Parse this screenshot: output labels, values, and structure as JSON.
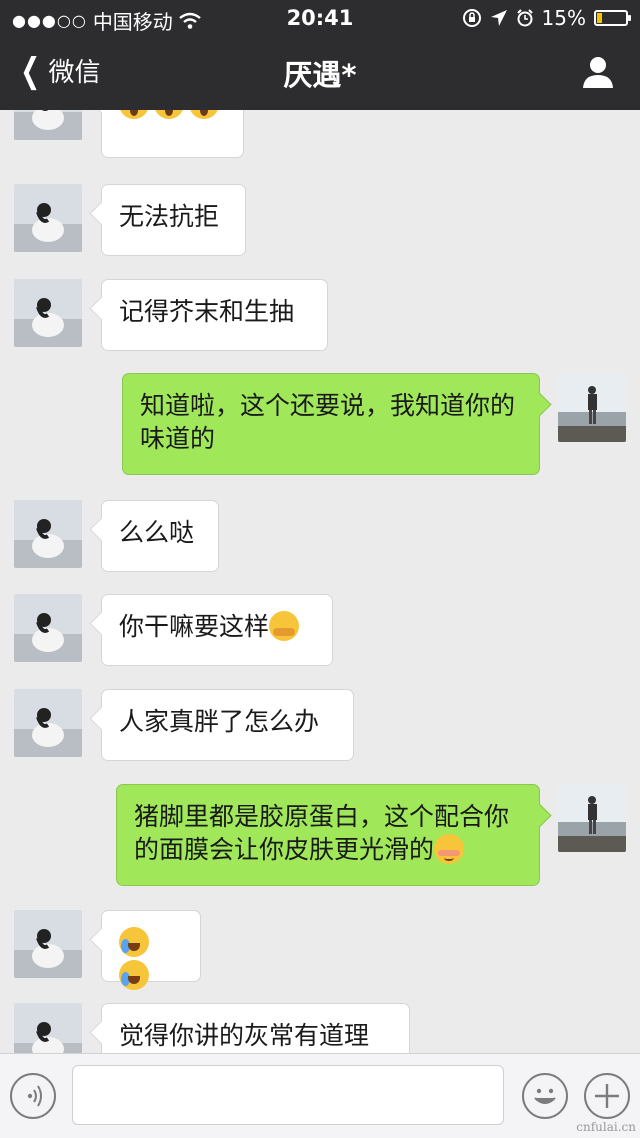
{
  "status_bar": {
    "signal": "●●●○○",
    "carrier": "中国移动",
    "time": "20:41",
    "battery": "15%",
    "battery_level": 0.15
  },
  "nav": {
    "back_label": "微信",
    "title": "厌遇*"
  },
  "messages": [
    {
      "side": "in",
      "text": "",
      "emoji": [
        "scream-emoji",
        "scream-emoji",
        "scream-emoji"
      ]
    },
    {
      "side": "in",
      "text": "无法抗拒"
    },
    {
      "side": "in",
      "text": "记得芥末和生抽"
    },
    {
      "side": "out",
      "text": "知道啦，这个还要说，我知道你的味道的"
    },
    {
      "side": "in",
      "text": "么么哒"
    },
    {
      "side": "in",
      "text": "你干嘛要这样",
      "emoji": [
        "hug-emoji"
      ]
    },
    {
      "side": "in",
      "text": "人家真胖了怎么办"
    },
    {
      "side": "out",
      "text": "猪脚里都是胶原蛋白，这个配合你的面膜会让你皮肤更光滑的",
      "emoji": [
        "blush-emoji"
      ]
    },
    {
      "side": "in",
      "text": "",
      "emoji": [
        "laugh-cry-emoji",
        "laugh-cry-emoji"
      ]
    },
    {
      "side": "in",
      "text": "觉得你讲的灰常有道理"
    }
  ],
  "input": {
    "value": "",
    "placeholder": ""
  },
  "watermark": "cnfulai.cn",
  "colors": {
    "header_bg": "#2d2d2f",
    "chat_bg": "#ebebeb",
    "outgoing_bubble": "#a0e75a",
    "incoming_bubble": "#ffffff"
  },
  "icons": [
    "back-chevron-icon",
    "contact-profile-icon",
    "voice-icon",
    "emoji-face-icon",
    "plus-icon",
    "wifi-icon",
    "lock-rotation-icon",
    "location-arrow-icon",
    "alarm-icon",
    "battery-icon"
  ]
}
